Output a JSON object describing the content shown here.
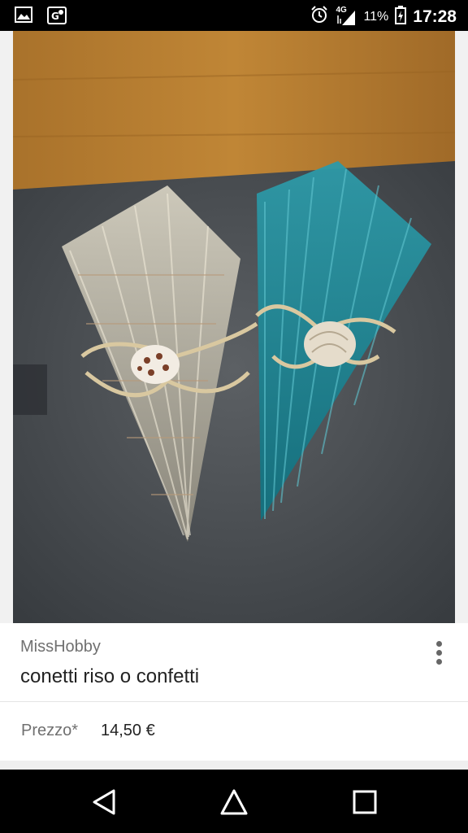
{
  "status_bar": {
    "network": "4G",
    "battery_percent": "11%",
    "time": "17:28"
  },
  "listing": {
    "seller": "MissHobby",
    "title": "conetti riso o confetti",
    "price_label": "Prezzo*",
    "price_value": "14,50 €"
  },
  "icons": [
    "gallery-icon",
    "maps-icon",
    "alarm-icon",
    "signal-icon",
    "battery-icon",
    "more-options-icon",
    "back-icon",
    "home-icon",
    "recents-icon"
  ],
  "colors": {
    "status_bar": "#000000",
    "nav_bar": "#000000",
    "photo_background": "#f1f1f1"
  }
}
